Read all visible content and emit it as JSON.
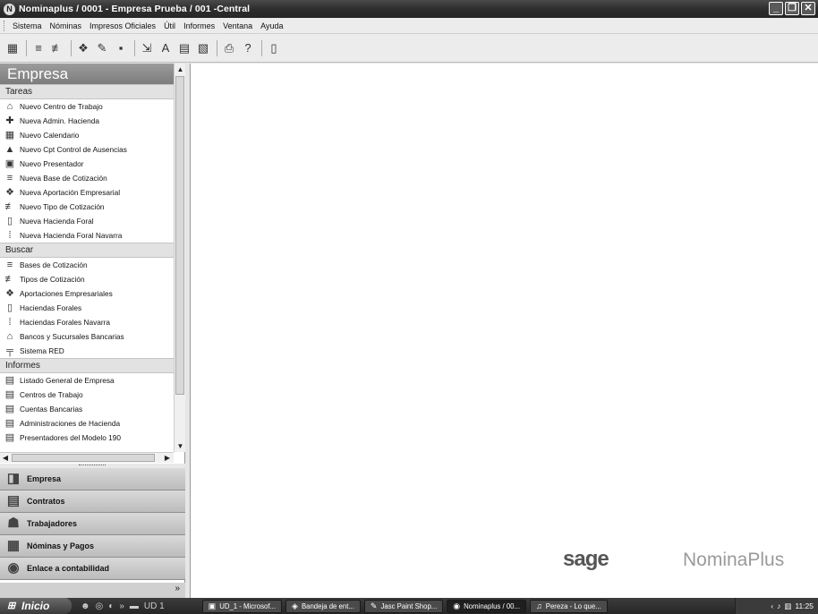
{
  "window": {
    "title": "Nominaplus / 0001 - Empresa Prueba / 001 -Central",
    "app_icon": "N"
  },
  "menubar": {
    "items": [
      "Sistema",
      "Nóminas",
      "Impresos Oficiales",
      "Útil",
      "Informes",
      "Ventana",
      "Ayuda"
    ]
  },
  "toolbar": {
    "icons": [
      "calculator-icon",
      "bases-icon",
      "tipos-icon",
      "aportaciones-icon",
      "edit-icon",
      "record-icon",
      "export-icon",
      "font-icon",
      "calendar-icon",
      "report-icon",
      "print-icon",
      "help-icon",
      "document-icon"
    ]
  },
  "explorer": {
    "header": "Empresa",
    "sections": [
      {
        "title": "Tareas",
        "items": [
          "Nuevo Centro de Trabajo",
          "Nueva Admin. Hacienda",
          "Nuevo Calendario",
          "Nuevo Cpt Control de Ausencias",
          "Nuevo Presentador",
          "Nueva Base de Cotización",
          "Nueva Aportación Empresarial",
          "Nuevo Tipo de Cotización",
          "Nueva Hacienda Foral",
          "Nueva Hacienda Foral Navarra"
        ]
      },
      {
        "title": "Buscar",
        "items": [
          "Bases de Cotización",
          "Tipos de Cotización",
          "Aportaciones Empresariales",
          "Haciendas Forales",
          "Haciendas Forales Navarra",
          "Bancos y Sucursales Bancarias",
          "Sistema RED"
        ]
      },
      {
        "title": "Informes",
        "items": [
          "Listado General de Empresa",
          "Centros de Trabajo",
          "Cuentas Bancarias",
          "Administraciones de Hacienda",
          "Presentadores del Modelo 190"
        ]
      }
    ]
  },
  "navigation": {
    "buttons": [
      "Empresa",
      "Contratos",
      "Trabajadores",
      "Nóminas y Pagos",
      "Enlace a contabilidad"
    ]
  },
  "branding": {
    "sage": "sage",
    "product": "NominaPlus"
  },
  "taskbar": {
    "start": "Inicio",
    "quick_folder": "UD 1",
    "tasks": [
      "UD_1 - Microsof...",
      "Bandeja de ent...",
      "Jasc Paint Shop...",
      "Nominaplus / 00...",
      "Pereza - Lo que..."
    ],
    "active_index": 3,
    "clock": "11:25"
  }
}
